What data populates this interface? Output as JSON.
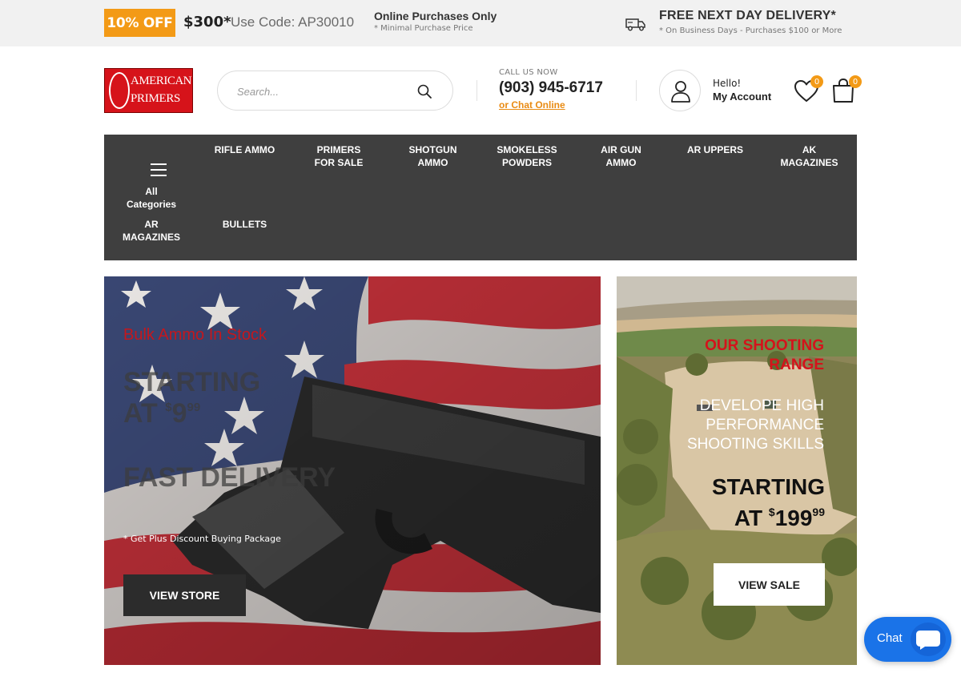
{
  "promo": {
    "badge": "10% OFF",
    "amount": "$300*",
    "code": "Use Code: AP30010",
    "online": "Online Purchases Only",
    "min_note": "* Minimal Purchase Price",
    "free_delivery": "FREE NEXT DAY DELIVERY*",
    "delivery_note": "* On Business Days - Purchases $100 or More",
    "icon": "truck-icon"
  },
  "header": {
    "logo_line1": "AMERICAN",
    "logo_line2": "PRIMERS",
    "search_placeholder": "Search...",
    "call_label": "CALL US NOW",
    "phone": "(903) 945-6717",
    "chat_link": "or Chat Online",
    "account_hello": "Hello!",
    "account_label": "My Account",
    "wishlist_count": "0",
    "cart_count": "0"
  },
  "nav": {
    "all_line1": "All",
    "all_line2": "Categories",
    "items": [
      {
        "line1": "RIFLE AMMO",
        "line2": ""
      },
      {
        "line1": "PRIMERS",
        "line2": "FOR SALE"
      },
      {
        "line1": "SHOTGUN",
        "line2": "AMMO"
      },
      {
        "line1": "SMOKELESS",
        "line2": "POWDERS"
      },
      {
        "line1": "AIR GUN",
        "line2": "AMMO"
      },
      {
        "line1": "AR UPPERS",
        "line2": ""
      },
      {
        "line1": "AK",
        "line2": "MAGAZINES"
      },
      {
        "line1": "AR",
        "line2": "MAGAZINES"
      },
      {
        "line1": "BULLETS",
        "line2": ""
      }
    ]
  },
  "hero": {
    "kicker": "Bulk Ammo In Stock",
    "starting": "STARTING",
    "at": "AT",
    "price_sup": "$",
    "price_main": "9",
    "price_cents": "99",
    "fast": "FAST DELIVERY",
    "note": "* Get Plus Discount Buying Package",
    "button": "VIEW STORE"
  },
  "side": {
    "kicker_line1": "OUR SHOOTING",
    "kicker_line2": "RANGE",
    "sub_line1": "DEVELOPE HIGH",
    "sub_line2": "PERFORMANCE",
    "sub_line3": "SHOOTING SKILLS",
    "starting": "STARTING",
    "at": "AT",
    "price_sup": "$",
    "price_main": "199",
    "price_cents": "99",
    "button": "VIEW SALE"
  },
  "chat": {
    "label": "Chat"
  },
  "colors": {
    "accent": "#f39a16",
    "brand_red": "#d6131a",
    "nav_bg": "#3f3f3f",
    "chat_blue": "#1a73e8"
  }
}
